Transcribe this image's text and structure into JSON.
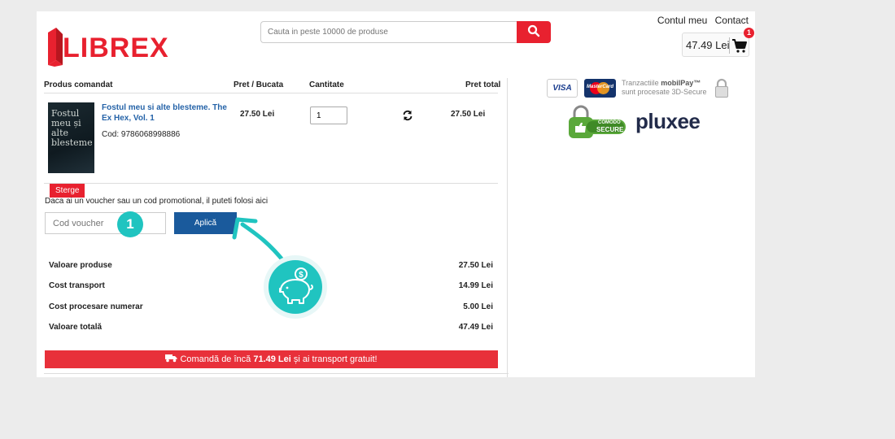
{
  "header": {
    "logo_text": "LIBREX",
    "search_placeholder": "Cauta in peste 10000 de produse",
    "links": [
      "Contul meu",
      "Contact"
    ],
    "cart_total": "47.49 Lei",
    "cart_count": "1"
  },
  "table": {
    "headers": {
      "product": "Produs comandat",
      "unit_price": "Pret / Bucata",
      "quantity": "Cantitate",
      "total": "Pret total"
    },
    "item": {
      "cover_text": "Fostul meu și alte blesteme",
      "name": "Fostul meu si alte blesteme. The Ex Hex, Vol. 1",
      "code": "Cod: 9786068998886",
      "unit_price": "27.50 Lei",
      "quantity": "1",
      "total": "27.50 Lei",
      "remove_label": "Sterge"
    }
  },
  "voucher": {
    "label": "Daca ai un voucher sau un cod promotional, il puteti folosi aici",
    "placeholder": "Cod voucher",
    "apply_label": "Aplică"
  },
  "summary": [
    {
      "label": "Valoare produse",
      "value": "27.50 Lei"
    },
    {
      "label": "Cost transport",
      "value": "14.99 Lei"
    },
    {
      "label": "Cost procesare numerar",
      "value": "5.00 Lei"
    },
    {
      "label": "Valoare totală",
      "value": "47.49 Lei"
    }
  ],
  "free_shipping": {
    "prefix": "Comandă de încă",
    "amount": "71.49 Lei",
    "suffix": "și ai transport gratuit!"
  },
  "badges": {
    "visa": "VISA",
    "mastercard": "MasterCard",
    "mobilpay_line1_prefix": "Tranzactiile",
    "mobilpay_brand": "mobilPay™",
    "mobilpay_line2": "sunt procesate 3D-Secure",
    "comodo_line1": "COMODO",
    "comodo_line2": "SECURE",
    "pluxee": "pluxee"
  },
  "annotation": {
    "step_number": "1",
    "accent_color": "#20c4c0"
  },
  "colors": {
    "brand_red": "#e8212f",
    "button_blue": "#1a5a9c",
    "link_blue": "#2563a8"
  }
}
